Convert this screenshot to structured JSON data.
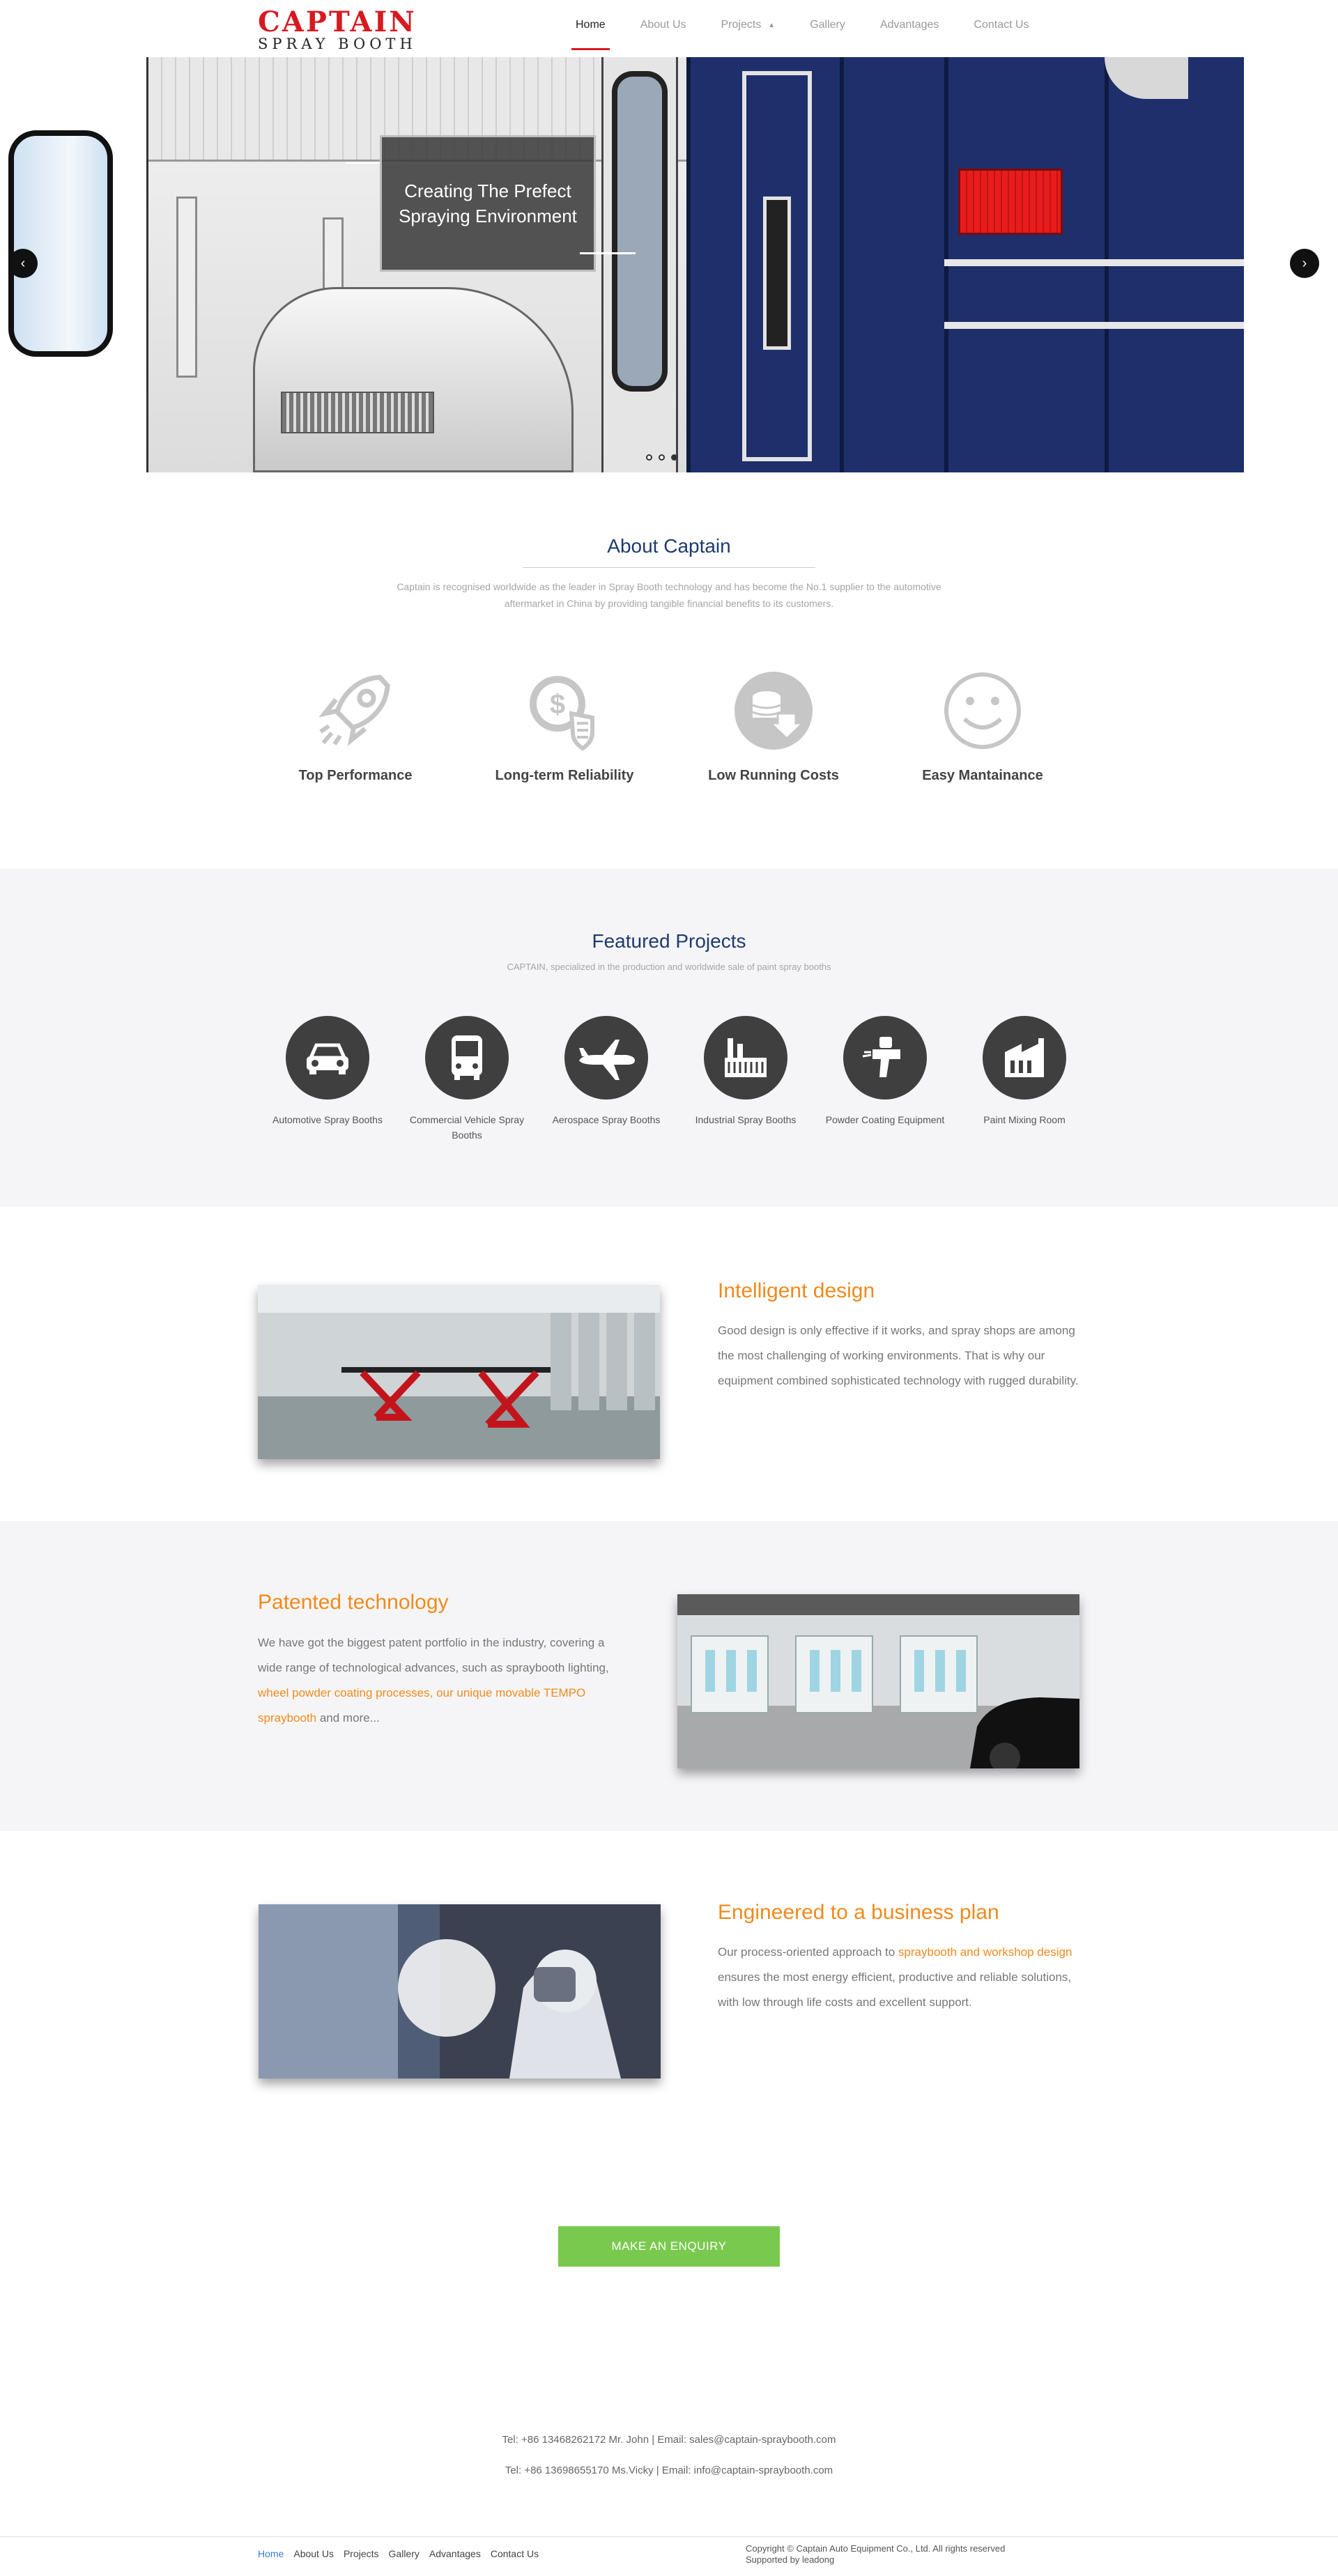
{
  "brand": {
    "line1": "CAPTAIN",
    "line2": "SPRAY BOOTH",
    "color": "#d71920"
  },
  "nav": {
    "items": [
      {
        "label": "Home",
        "active": true
      },
      {
        "label": "About Us"
      },
      {
        "label": "Projects",
        "has_dropdown": true
      },
      {
        "label": "Gallery"
      },
      {
        "label": "Advantages"
      },
      {
        "label": "Contact Us"
      }
    ]
  },
  "hero": {
    "caption_line1": "Creating The Prefect",
    "caption_line2": "Spraying Environment",
    "slide_count": 3,
    "active_slide": 1
  },
  "about": {
    "title": "About Captain",
    "text": "Captain is recognised worldwide as the leader in Spray Booth technology and has become the No.1 supplier to the automotive aftermarket in China by providing tangible financial benefits to its customers.",
    "features": [
      {
        "label": "Top Performance",
        "icon": "rocket-icon"
      },
      {
        "label": "Long-term Reliability",
        "icon": "dollar-shield-icon"
      },
      {
        "label": "Low Running Costs",
        "icon": "coins-down-icon"
      },
      {
        "label": "Easy Mantainance",
        "icon": "smiley-icon"
      }
    ]
  },
  "featured": {
    "title": "Featured Projects",
    "subtitle": "CAPTAIN, specialized in the production and worldwide sale of paint spray booths",
    "projects": [
      {
        "label": "Automotive Spray Booths",
        "icon": "car-icon"
      },
      {
        "label": "Commercial Vehicle Spray Booths",
        "icon": "bus-icon"
      },
      {
        "label": "Aerospace Spray Booths",
        "icon": "airplane-icon"
      },
      {
        "label": "Industrial Spray Booths",
        "icon": "factory-icon"
      },
      {
        "label": "Powder Coating Equipment",
        "icon": "spray-gun-icon"
      },
      {
        "label": "Paint Mixing Room",
        "icon": "building-icon"
      }
    ]
  },
  "sections": {
    "intelligent": {
      "title": "Intelligent design",
      "text": "Good design is only effective if it works, and spray shops are among the most challenging of working environments. That is why our equipment combined sophisticated technology with rugged durability."
    },
    "patented": {
      "title": "Patented technology",
      "text_before": "We have got the biggest patent portfolio in the industry, covering a wide range of technological advances, such as spraybooth lighting, ",
      "link": "wheel powder coating processes, our unique movable TEMPO spraybooth",
      "text_after": " and more..."
    },
    "engineered": {
      "title": "Engineered to a business plan",
      "text_before": "Our process-oriented approach to ",
      "link": "spraybooth and workshop design",
      "text_after": " ensures the most energy efficient, productive and reliable solutions, with low through life costs and excellent support."
    },
    "accent_color": "#f08a1c"
  },
  "enquiry": {
    "label": "MAKE AN ENQUIRY",
    "color": "#7ac94f"
  },
  "contacts": {
    "line1": "Tel: +86 13468262172 Mr. John  |  Email: sales@captain-spraybooth.com",
    "line2": "Tel: +86 13698655170 Ms.Vicky  |  Email: info@captain-spraybooth.com"
  },
  "footer": {
    "links": [
      "Home",
      "About Us",
      "Projects",
      "Gallery",
      "Advantages",
      "Contact Us"
    ],
    "copyright": "Copyright © Captain Auto Equipment Co., Ltd. All rights reserved",
    "supported": "Supported by leadong"
  }
}
